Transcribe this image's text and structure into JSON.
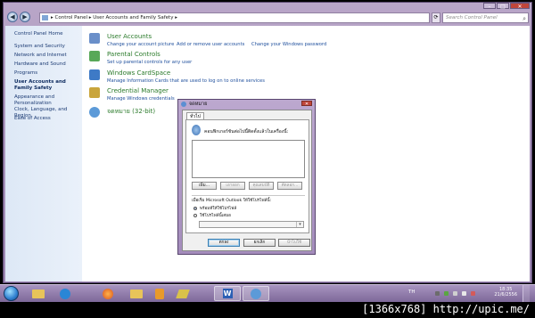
{
  "window": {
    "buttons": {
      "minimize": "–",
      "maximize": "□",
      "close": "✕"
    }
  },
  "nav": {
    "back": "◀",
    "forward": "▶",
    "address": "▸ Control Panel ▸ User Accounts and Family Safety ▸",
    "refresh": "⟳",
    "search_placeholder": "Search Control Panel",
    "search_icon": "⌕"
  },
  "sidebar": {
    "items": [
      "Control Panel Home",
      "System and Security",
      "Network and Internet",
      "Hardware and Sound",
      "Programs",
      "User Accounts and Family Safety",
      "Appearance and Personalization",
      "Clock, Language, and Region",
      "Ease of Access"
    ]
  },
  "categories": [
    {
      "title": "User Accounts",
      "links": [
        "Change your account picture",
        "Add or remove user accounts",
        "Change your Windows password"
      ],
      "color": "#6a8fc9"
    },
    {
      "title": "Parental Controls",
      "links": [
        "Set up parental controls for any user"
      ],
      "color": "#58a858"
    },
    {
      "title": "Windows CardSpace",
      "links": [
        "Manage Information Cards that are used to log on to online services"
      ],
      "color": "#3e7ac6"
    },
    {
      "title": "Credential Manager",
      "links": [
        "Manage Windows credentials"
      ],
      "color": "#c9a53c"
    },
    {
      "title": "จดหมาย (32-bit)",
      "links": [],
      "color": "#5c9ad8"
    }
  ],
  "dialog": {
    "title": "จดหมาย",
    "close": "✕",
    "tab": "ทั่วไป",
    "question": "คอนฟิกเกอร์ชันต่อไปนี้ติดตั้งแล้วในเครื่องนี้:",
    "profile_buttons": [
      "เพิ่ม...",
      "เอาออก",
      "คุณสมบัติ",
      "คัดลอก..."
    ],
    "startup_label": "เมื่อเริ่ม Microsoft Outlook ให้ใช้โปรไฟล์นี้:",
    "radio_prompt": "พร้อมท์ให้ใช้โปรไฟล์",
    "radio_always": "ใช้โปรไฟล์นี้เสมอ",
    "combo_arrow": "▾",
    "buttons": [
      "ตกลง",
      "ยกเลิก",
      "นำไปใช้"
    ]
  },
  "taskbar": {
    "lang": "TH",
    "time": "18:35",
    "date": "21/6/2556",
    "apps": [
      "folder",
      "ie",
      "firefox",
      "folder2",
      "media",
      "winamp",
      "word",
      "mail"
    ]
  },
  "watermark": "[1366x768] http://upic.me/"
}
